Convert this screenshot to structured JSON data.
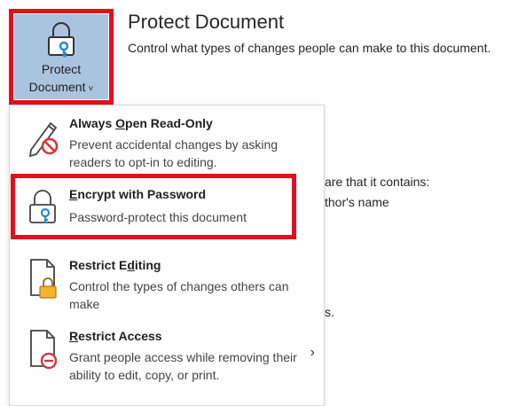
{
  "header": {
    "title": "Protect Document",
    "description": "Control what types of changes people can make to this document."
  },
  "protect_button": {
    "line1": "Protect",
    "line2": "Document",
    "chevron": "˅"
  },
  "background_text": {
    "line1": "are that it contains:",
    "line2": "thor's name",
    "line3": "s."
  },
  "menu": {
    "items": [
      {
        "title_pre": "Always ",
        "title_ul": "O",
        "title_post": "pen Read-Only",
        "description": "Prevent accidental changes by asking readers to opt-in to editing.",
        "icon": "pencil-no-icon"
      },
      {
        "title_pre": "",
        "title_ul": "E",
        "title_post": "ncrypt with Password",
        "description": "Password-protect this document",
        "icon": "lock-key-icon"
      },
      {
        "title_pre": "Restrict E",
        "title_ul": "d",
        "title_post": "iting",
        "description": "Control the types of changes others can make",
        "icon": "document-lock-icon"
      },
      {
        "title_pre": "",
        "title_ul": "R",
        "title_post": "estrict Access",
        "description": "Grant people access while removing their ability to edit, copy, or print.",
        "icon": "document-restrict-icon",
        "arrow": "›"
      }
    ]
  },
  "colors": {
    "button_bg": "#a9c4df",
    "highlight_red": "#e2101c",
    "lock_yellow": "#f2b32e",
    "no_sign_red": "#d13438",
    "key_blue": "#2b88d8"
  }
}
